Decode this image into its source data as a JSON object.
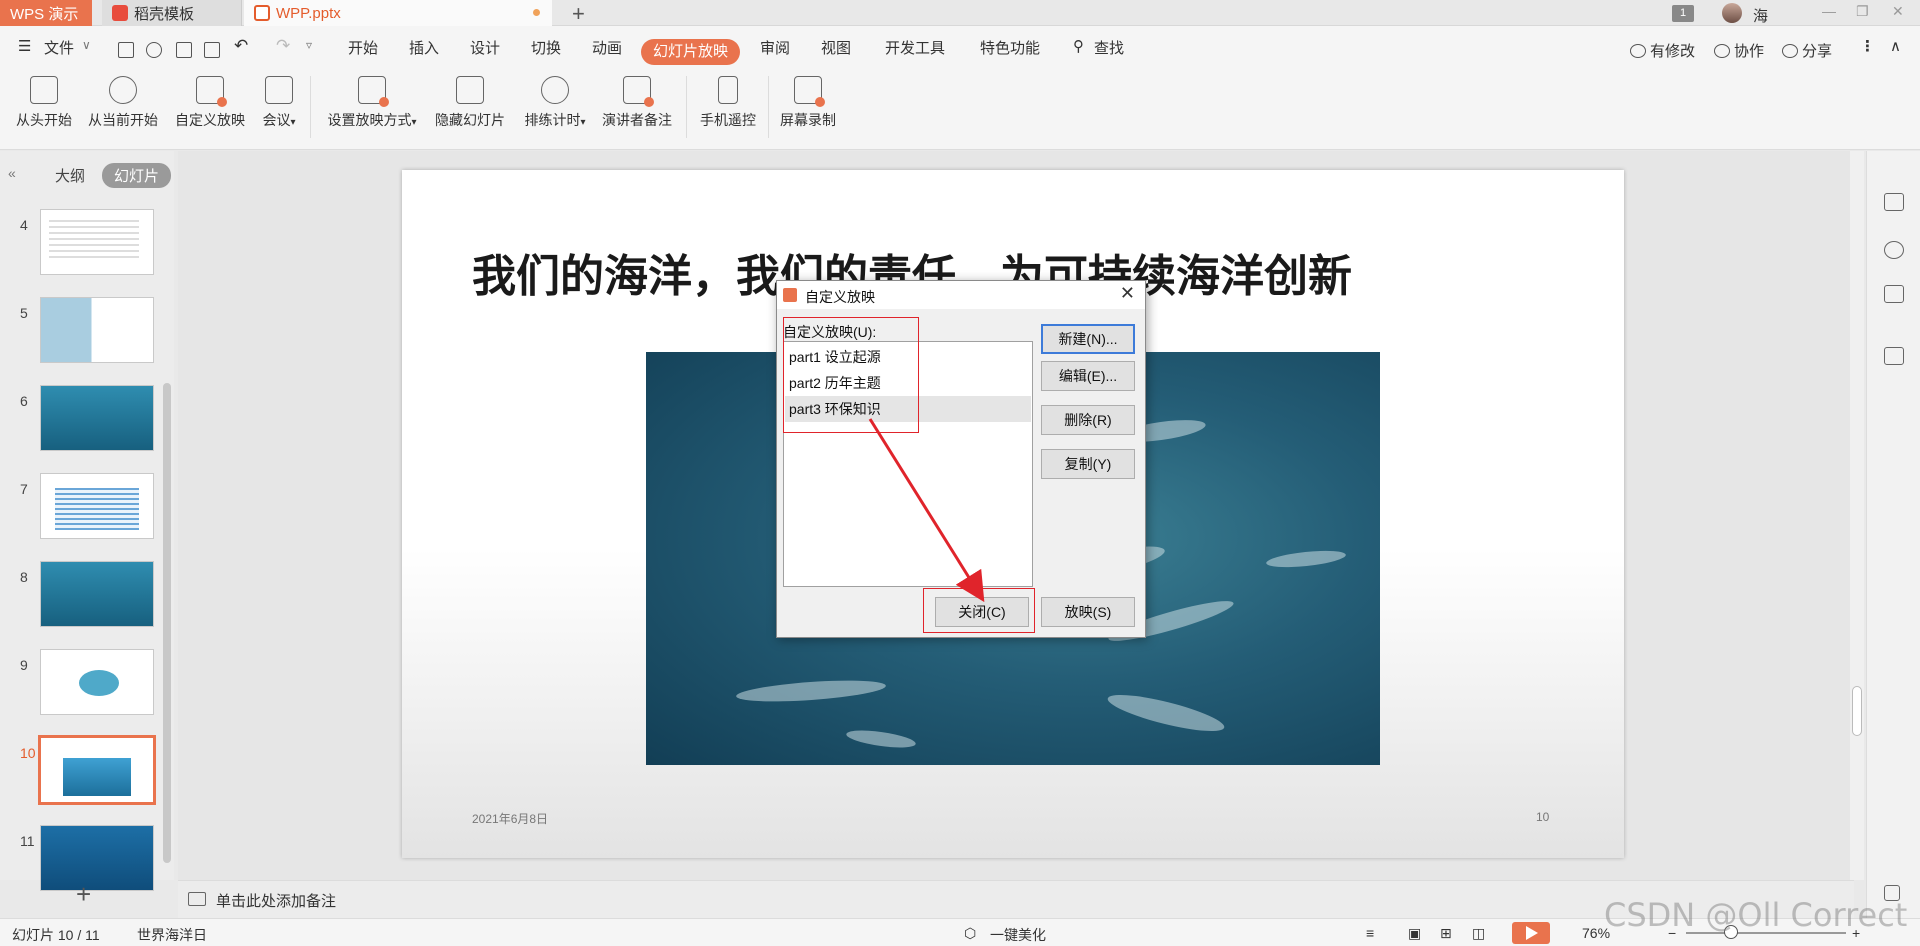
{
  "titlebar": {
    "app_tab": "WPS 演示",
    "doc_tabs": [
      "稻壳模板",
      "WPP.pptx"
    ],
    "window_count_badge": "1",
    "user_name": "海"
  },
  "menubar": {
    "file": "文件",
    "items": [
      "开始",
      "插入",
      "设计",
      "切换",
      "动画",
      "幻灯片放映",
      "审阅",
      "视图",
      "开发工具",
      "特色功能",
      "查找"
    ],
    "active_item": "幻灯片放映",
    "right_tools": [
      "有修改",
      "协作",
      "分享"
    ]
  },
  "ribbon": {
    "buttons": [
      "从头开始",
      "从当前开始",
      "自定义放映",
      "会议",
      "设置放映方式",
      "隐藏幻灯片",
      "排练计时",
      "演讲者备注",
      "手机遥控",
      "屏幕录制"
    ]
  },
  "left_panel": {
    "tabs": [
      "大纲",
      "幻灯片"
    ],
    "active_tab": "幻灯片",
    "slides": [
      {
        "num": "4",
        "kind": "doc"
      },
      {
        "num": "5",
        "kind": "bear"
      },
      {
        "num": "6",
        "kind": "ocean"
      },
      {
        "num": "7",
        "kind": "table"
      },
      {
        "num": "8",
        "kind": "ocean"
      },
      {
        "num": "9",
        "kind": "whale"
      },
      {
        "num": "10",
        "kind": "cur",
        "active": true
      },
      {
        "num": "11",
        "kind": "title11"
      }
    ]
  },
  "slide": {
    "title": "我们的海洋，我们的责任，为可持续海洋创新",
    "date": "2021年6月8日",
    "number": "10"
  },
  "notes": {
    "placeholder": "单击此处添加备注"
  },
  "statusbar": {
    "slide_counter": "幻灯片 10 / 11",
    "theme_name": "世界海洋日",
    "beautify": "一键美化",
    "zoom": "76%"
  },
  "dialog": {
    "title": "自定义放映",
    "list_label": "自定义放映(U):",
    "shows": [
      "part1 设立起源",
      "part2 历年主题",
      "part3 环保知识"
    ],
    "selected_index": 2,
    "buttons": {
      "new": "新建(N)...",
      "edit": "编辑(E)...",
      "delete": "删除(R)",
      "copy": "复制(Y)",
      "close": "关闭(C)",
      "show": "放映(S)"
    }
  },
  "watermark": "CSDN @Oll Correct",
  "colors": {
    "accent": "#e9734d",
    "annotation_red": "#e0242b"
  }
}
